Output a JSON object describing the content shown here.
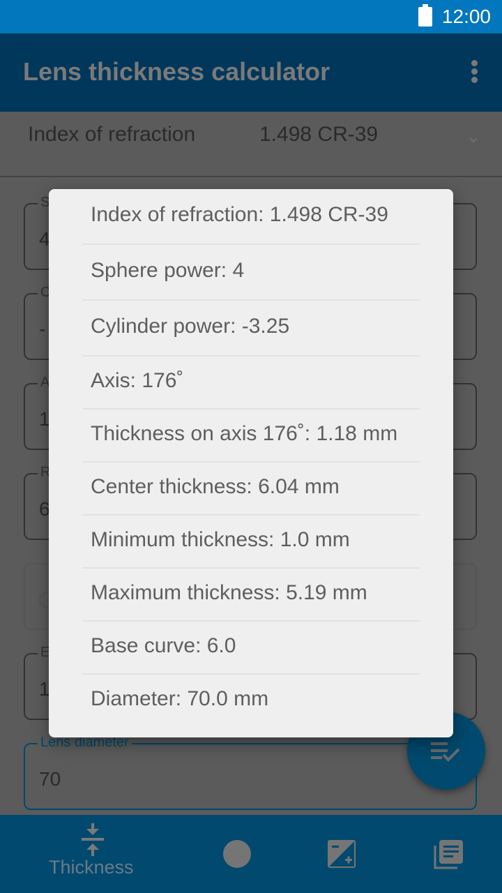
{
  "status_bar": {
    "time": "12:00",
    "battery_icon": "battery-full-icon"
  },
  "app_bar": {
    "title": "Lens thickness calculator",
    "menu_icon": "more-vert-icon"
  },
  "form": {
    "index_of_refraction": {
      "label": "Index of refraction",
      "value": "1.498 CR-39"
    },
    "fields": [
      {
        "label_partial": "S",
        "value_partial": "4"
      },
      {
        "label_partial": "C",
        "value_partial": "-"
      },
      {
        "label_partial": "A",
        "value_partial": "1"
      },
      {
        "label_partial": "R",
        "value_partial": "6"
      },
      {
        "label_partial": "",
        "value_partial": ""
      },
      {
        "label_partial": "E",
        "value_partial": "1"
      }
    ],
    "lens_diameter": {
      "label": "Lens diameter",
      "value": "70"
    }
  },
  "fab": {
    "icon": "playlist-check-icon"
  },
  "dialog": {
    "rows": [
      "Index of refraction: 1.498 CR-39",
      "Sphere power: 4",
      "Cylinder power: -3.25",
      "Axis: 176˚",
      "Thickness on axis 176˚: 1.18 mm",
      "Center thickness: 6.04 mm",
      "Minimum thickness: 1.0 mm",
      "Maximum thickness: 5.19 mm",
      "Base curve: 6.0",
      "Diameter: 70.0 mm"
    ]
  },
  "bottom_nav": {
    "items": [
      {
        "label": "Thickness",
        "icon": "compress-vertical-icon"
      },
      {
        "label": "",
        "icon": "circle-icon"
      },
      {
        "label": "",
        "icon": "exposure-icon"
      },
      {
        "label": "",
        "icon": "library-books-icon"
      }
    ]
  },
  "colors": {
    "status_bar": "#0277bd",
    "primary_dark": "#01375a",
    "primary": "#01496e",
    "dialog_bg": "#efefef"
  }
}
